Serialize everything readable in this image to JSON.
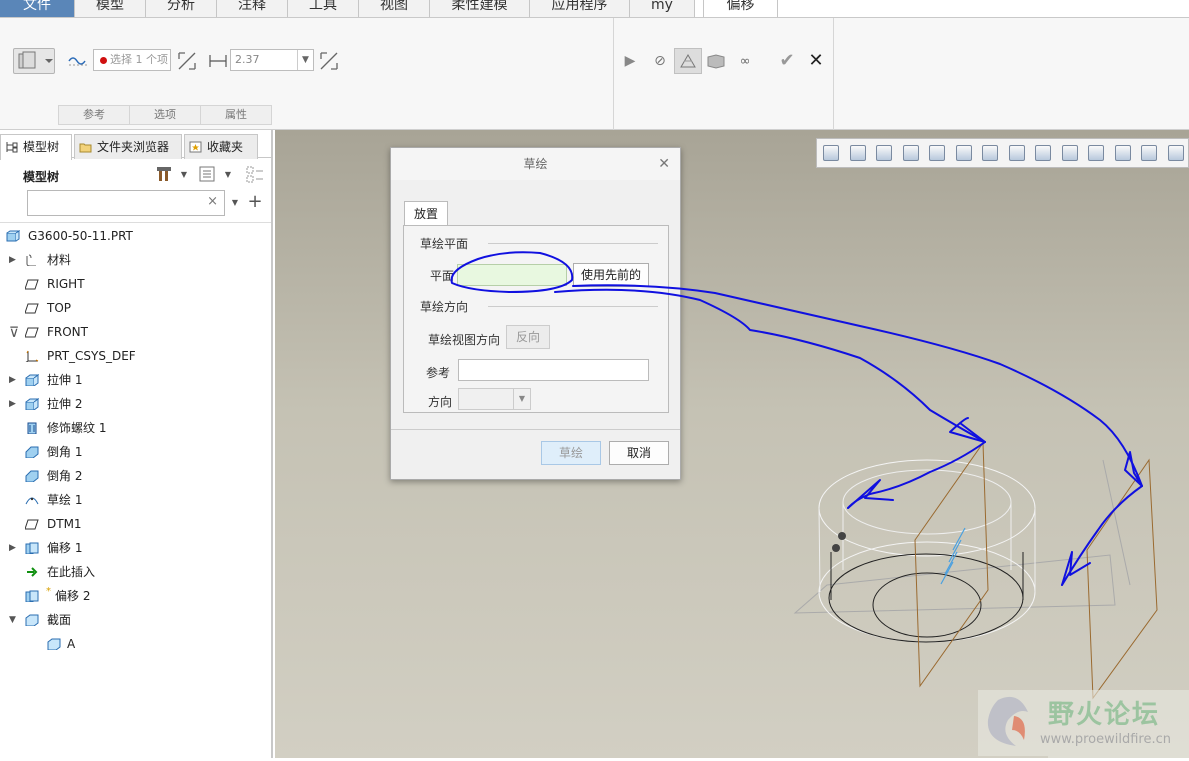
{
  "menubar": {
    "tabs": [
      "文件",
      "模型",
      "分析",
      "注释",
      "工具",
      "视图",
      "柔性建模",
      "应用程序",
      "my",
      "偏移"
    ]
  },
  "dashboard": {
    "select_placeholder": "选择 1 个项",
    "offset_value": "2.37",
    "tabs": [
      "参考",
      "选项",
      "属性"
    ]
  },
  "panel": {
    "tabs": [
      "模型树",
      "文件夹浏览器",
      "收藏夹"
    ],
    "tree_title": "模型树",
    "search_value": "",
    "items": [
      {
        "label": "G3600-50-11.PRT",
        "icon": "part-icon",
        "expand": ""
      },
      {
        "label": "材料",
        "icon": "material-icon",
        "expand": "▶"
      },
      {
        "label": "RIGHT",
        "icon": "datum-plane-icon",
        "expand": ""
      },
      {
        "label": "TOP",
        "icon": "datum-plane-icon",
        "expand": ""
      },
      {
        "label": "FRONT",
        "icon": "datum-plane-icon",
        "expand": ""
      },
      {
        "label": "PRT_CSYS_DEF",
        "icon": "csys-icon",
        "expand": ""
      },
      {
        "label": "拉伸 1",
        "icon": "extrude-icon",
        "expand": "▶"
      },
      {
        "label": "拉伸 2",
        "icon": "extrude-icon",
        "expand": "▶"
      },
      {
        "label": "修饰螺纹 1",
        "icon": "thread-icon",
        "expand": ""
      },
      {
        "label": "倒角 1",
        "icon": "chamfer-icon",
        "expand": ""
      },
      {
        "label": "倒角 2",
        "icon": "chamfer-icon",
        "expand": ""
      },
      {
        "label": "草绘 1",
        "icon": "sketch-icon",
        "expand": ""
      },
      {
        "label": "DTM1",
        "icon": "datum-plane-icon",
        "expand": ""
      },
      {
        "label": "偏移 1",
        "icon": "offset-icon",
        "expand": "▶"
      },
      {
        "label": "在此插入",
        "icon": "insert-arrow-icon",
        "expand": ""
      },
      {
        "label": "偏移 2",
        "icon": "offset-icon",
        "expand": ""
      },
      {
        "label": "截面",
        "icon": "section-icon",
        "expand": "▼"
      },
      {
        "label": "A",
        "icon": "section-icon",
        "expand": ""
      }
    ]
  },
  "dialog": {
    "title": "草绘",
    "tab": "放置",
    "group1": "草绘平面",
    "plane_label": "平面",
    "use_prev": "使用先前的",
    "group2": "草绘方向",
    "view_dir": "草绘视图方向",
    "flip": "反向",
    "ref_label": "参考",
    "dir_label": "方向",
    "sketch_btn": "草绘",
    "cancel_btn": "取消"
  },
  "watermark": {
    "name": "野火论坛",
    "url": "www.proewildfire.cn"
  },
  "colors": {
    "accent": "#5a86b8",
    "annotation": "#1010e0",
    "plane_field": "#e8f8e0"
  }
}
